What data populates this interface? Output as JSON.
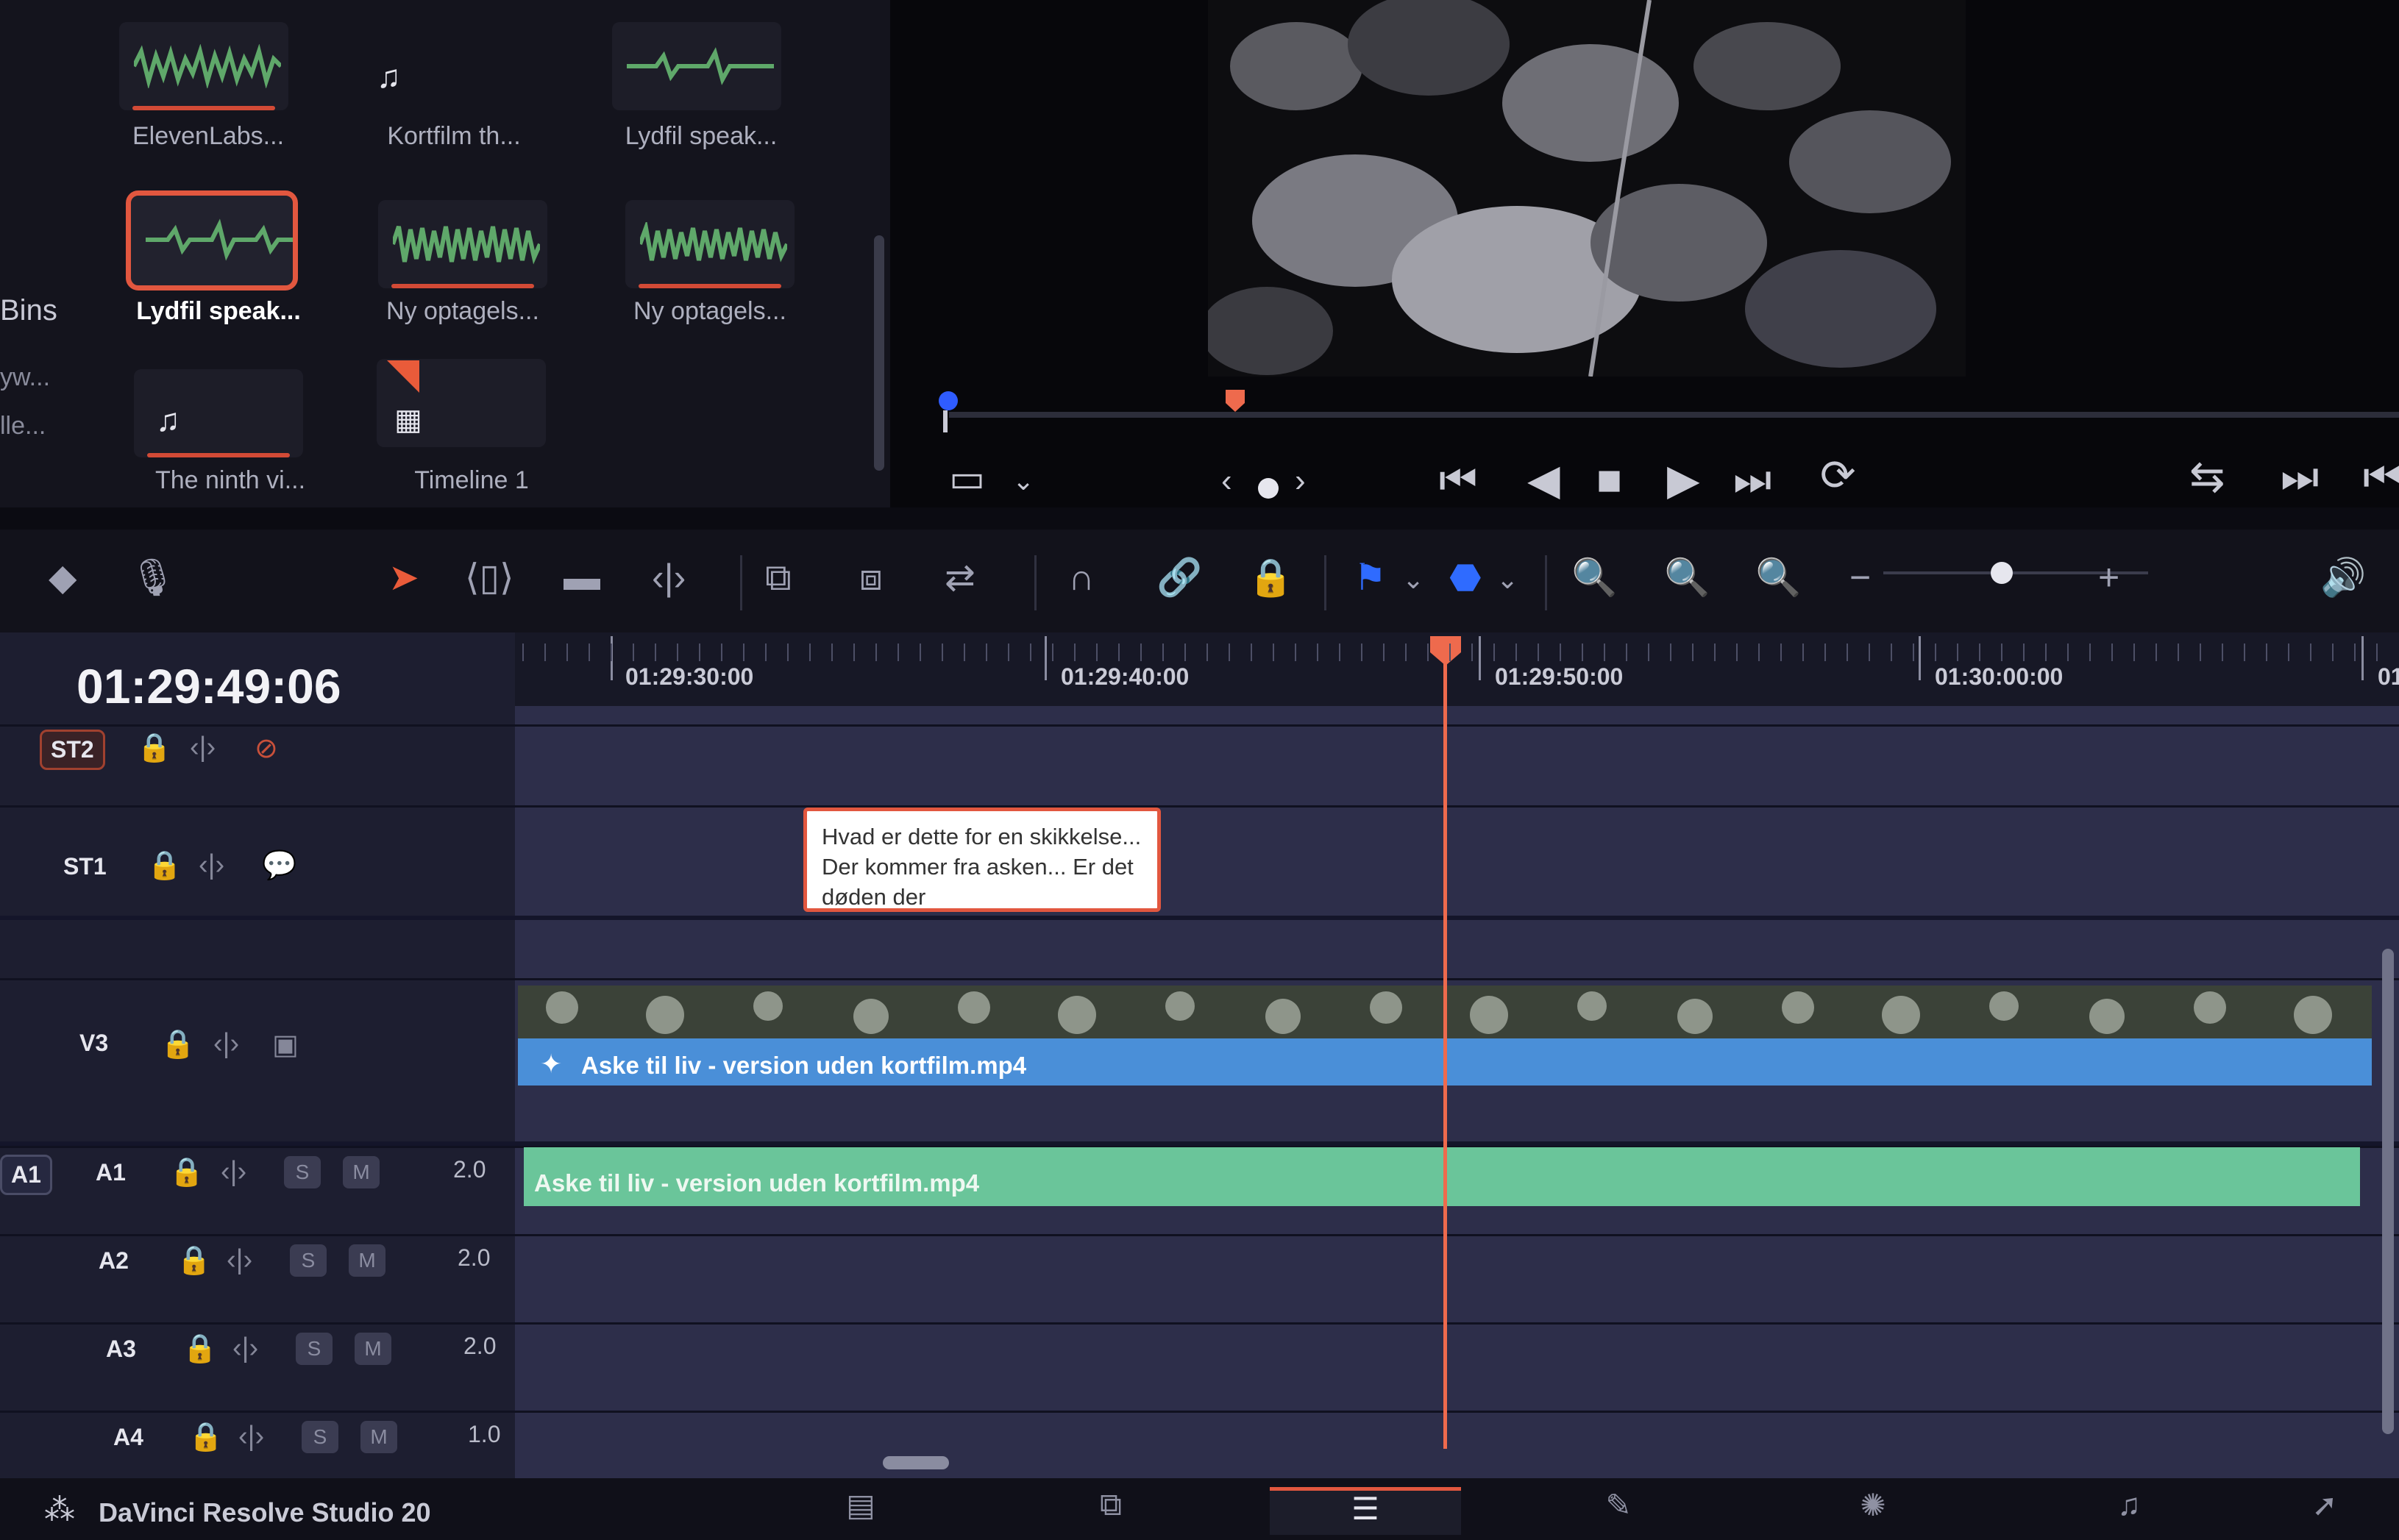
{
  "app": {
    "name": "DaVinci Resolve Studio 20"
  },
  "media_pool": {
    "bins_label": "Bins",
    "bin_items": [
      "yw...",
      "lle..."
    ],
    "clips": [
      {
        "label": "ElevenLabs...",
        "type": "audio"
      },
      {
        "label": "Kortfilm th...",
        "type": "music"
      },
      {
        "label": "Lydfil speak...",
        "type": "audio"
      },
      {
        "label": "Lydfil speak...",
        "type": "audio",
        "selected": true
      },
      {
        "label": "Ny optagels...",
        "type": "audio"
      },
      {
        "label": "Ny optagels...",
        "type": "audio"
      },
      {
        "label": "The ninth vi...",
        "type": "music"
      },
      {
        "label": "Timeline 1",
        "type": "timeline"
      }
    ]
  },
  "viewer": {
    "transport_icons": [
      "jump-to-start-icon",
      "play-reverse-icon",
      "stop-icon",
      "play-icon",
      "jump-to-end-icon",
      "loop-icon"
    ]
  },
  "timeline": {
    "timecode": "01:29:49:06",
    "ruler_labels": [
      "01:29:30:00",
      "01:29:40:00",
      "01:29:50:00",
      "01:30:00:00",
      "01"
    ],
    "tracks": [
      {
        "name": "ST2",
        "type": "subtitle"
      },
      {
        "name": "ST1",
        "type": "subtitle"
      },
      {
        "name": "V3",
        "type": "video"
      },
      {
        "name": "A1",
        "type": "audio",
        "gain": "2.0",
        "patch": "A1"
      },
      {
        "name": "A2",
        "type": "audio",
        "gain": "2.0"
      },
      {
        "name": "A3",
        "type": "audio",
        "gain": "2.0"
      },
      {
        "name": "A4",
        "type": "audio",
        "gain": "1.0"
      }
    ],
    "solo_label": "S",
    "mute_label": "M",
    "subtitle_text": "Hvad er dette for en skikkelse... Der kommer fra asken... Er det døden der",
    "video_clip": "Aske til liv - version uden kortfilm.mp4",
    "audio_clip": "Aske til liv - version uden kortfilm.mp4"
  },
  "colors": {
    "accent": "#e2573f",
    "video_clip": "#4a8fd8",
    "audio_clip": "#6ac59a",
    "timeline_bg": "#2d2e4a"
  }
}
